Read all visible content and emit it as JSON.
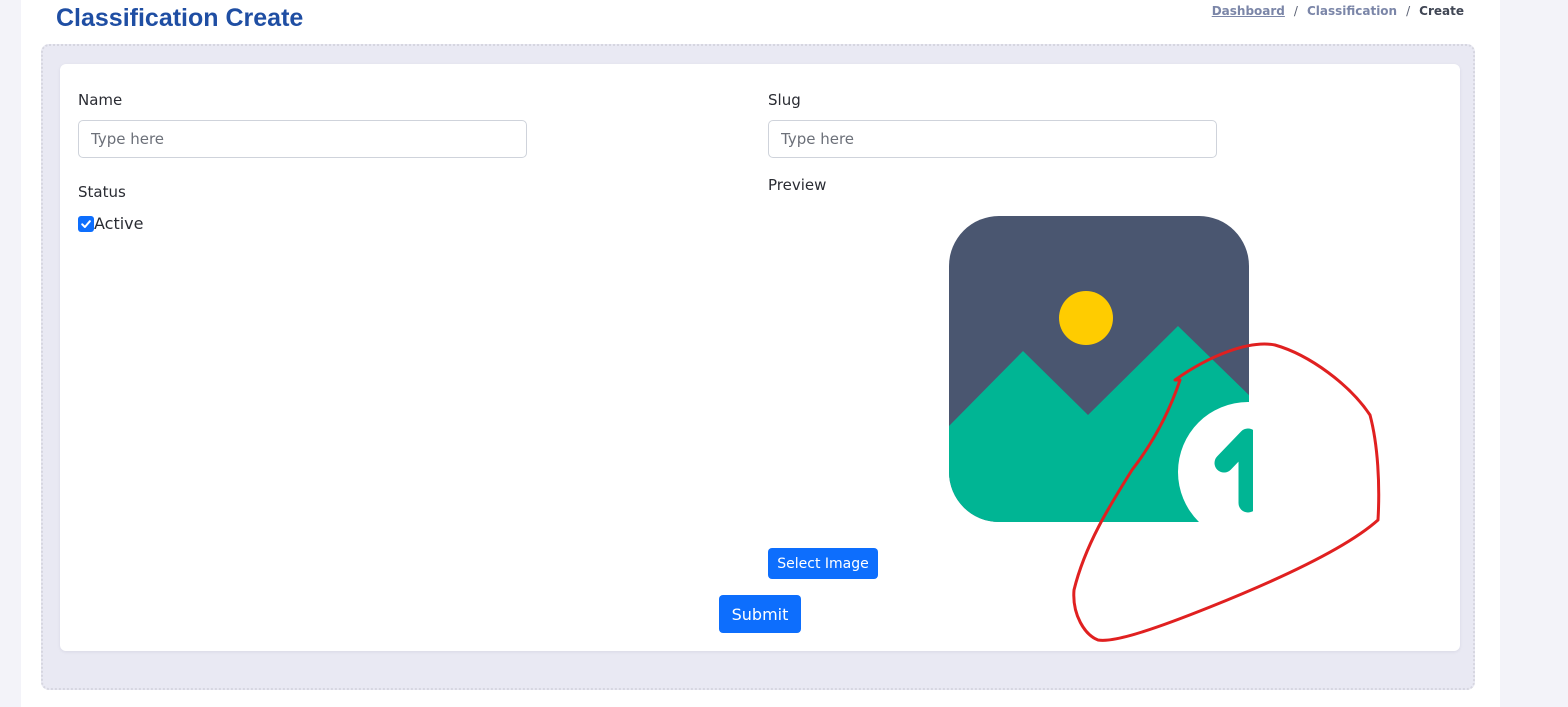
{
  "header": {
    "title": "Classification Create",
    "breadcrumb": {
      "items": [
        "Dashboard",
        "Classification"
      ],
      "separator": "/",
      "current": "Create"
    }
  },
  "form": {
    "name_label": "Name",
    "name_placeholder": "Type here",
    "name_value": "",
    "slug_label": "Slug",
    "slug_placeholder": "Type here",
    "slug_value": "",
    "status_label": "Status",
    "status_checkbox_label": "Active",
    "status_checked": true,
    "preview_label": "Preview",
    "preview_icon": "image-upload-placeholder-icon",
    "select_image_label": "Select Image",
    "submit_label": "Submit"
  },
  "colors": {
    "title": "#1f4ea3",
    "primary_button": "#0d6efd",
    "image_frame": "#4a5670",
    "image_mountain": "#00b594",
    "image_sun": "#ffcc00",
    "annotation_stroke": "#e02020"
  }
}
